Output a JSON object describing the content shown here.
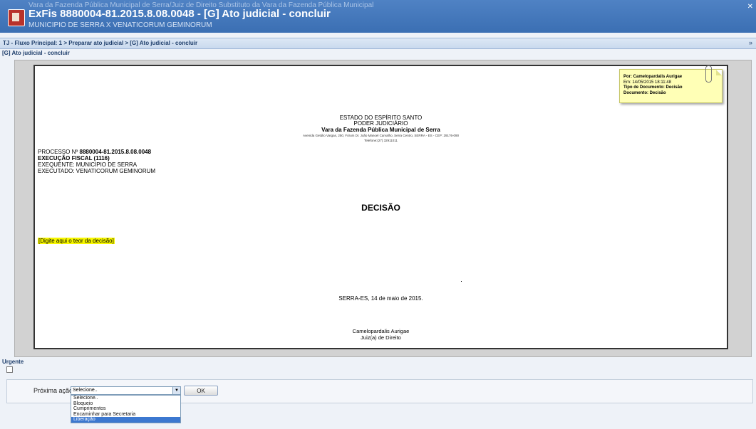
{
  "window": {
    "superscript": "Vara da Fazenda Pública Municipal de Serra/Juiz de Direito Substituto da Vara da Fazenda Pública Municipal",
    "title": "ExFis 8880004-81.2015.8.08.0048 - [G] Ato judicial - concluir",
    "subtitle": "MUNICIPIO DE SERRA X VENATICORUM GEMINORUM"
  },
  "breadcrumb": "TJ - Fluxo Principal: 1 > Preparar ato judicial > [G] Ato judicial - concluir",
  "task_label": "[G] Ato judicial - concluir",
  "note": {
    "por": "Por: Camelopardalis Aurigae",
    "em": "Em: 14/05/2015 18:11:48",
    "tipo": "Tipo de Documento: Decisão",
    "documento": "Documento: Decisão"
  },
  "document": {
    "header": [
      "ESTADO DO ESPÍRITO SANTO",
      "PODER JUDICIÁRIO",
      "Vara da Fazenda Pública Municipal de Serra"
    ],
    "address": "Avenida Getúlio Vargas, 250, Fórum Dr. João Manoel Carvalho, Serra Centro, SERRA - ES - CEP: 29176-090",
    "phone": "Telefone:(27) 32911011",
    "processo_label": "PROCESSO Nº",
    "processo_number": "8880004-81.2015.8.08.0048",
    "execucao": "EXECUÇÃO FISCAL (1116)",
    "exequente": "EXEQUENTE: MUNICIPIO DE SERRA",
    "executado": "EXECUTADO: VENATICORUM GEMINORUM",
    "heading": "DECISÃO",
    "placeholder": "[Digite aqui o teor da decisão]",
    "local_date": "SERRA-ES, 14 de maio de 2015.",
    "signer": "Camelopardalis Aurigae",
    "signer_role": "Juiz(a) de Direito"
  },
  "urgent_label": "Urgente",
  "next_action": {
    "label": "Próxima ação:",
    "selected": "Selecione..",
    "options": [
      "Selecione..",
      "Bloqueio",
      "Cumprimentos",
      "Encaminhar para Secretaria",
      "Liberação"
    ],
    "highlighted_index": 4,
    "ok_label": "OK"
  }
}
